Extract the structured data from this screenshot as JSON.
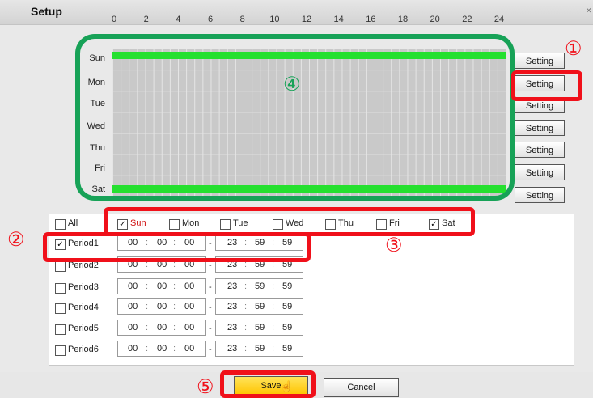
{
  "window": {
    "title": "Setup",
    "close_glyph": "×"
  },
  "hours": [
    "0",
    "2",
    "4",
    "6",
    "8",
    "10",
    "12",
    "14",
    "16",
    "18",
    "20",
    "22",
    "24"
  ],
  "days": [
    {
      "label": "Sun",
      "setting": "Setting",
      "full": true
    },
    {
      "label": "Mon",
      "setting": "Setting",
      "full": false
    },
    {
      "label": "Tue",
      "setting": "Setting",
      "full": false
    },
    {
      "label": "Wed",
      "setting": "Setting",
      "full": false
    },
    {
      "label": "Thu",
      "setting": "Setting",
      "full": false
    },
    {
      "label": "Fri",
      "setting": "Setting",
      "full": false
    },
    {
      "label": "Sat",
      "setting": "Setting",
      "full": true
    }
  ],
  "day_checks": {
    "all": {
      "label": "All",
      "checked": false
    },
    "items": [
      {
        "label": "Sun",
        "checked": true
      },
      {
        "label": "Mon",
        "checked": false
      },
      {
        "label": "Tue",
        "checked": false
      },
      {
        "label": "Wed",
        "checked": false
      },
      {
        "label": "Thu",
        "checked": false
      },
      {
        "label": "Fri",
        "checked": false
      },
      {
        "label": "Sat",
        "checked": true
      }
    ]
  },
  "periods": [
    {
      "label": "Period1",
      "checked": true,
      "start": [
        "00",
        "00",
        "00"
      ],
      "end": [
        "23",
        "59",
        "59"
      ]
    },
    {
      "label": "Period2",
      "checked": false,
      "start": [
        "00",
        "00",
        "00"
      ],
      "end": [
        "23",
        "59",
        "59"
      ]
    },
    {
      "label": "Period3",
      "checked": false,
      "start": [
        "00",
        "00",
        "00"
      ],
      "end": [
        "23",
        "59",
        "59"
      ]
    },
    {
      "label": "Period4",
      "checked": false,
      "start": [
        "00",
        "00",
        "00"
      ],
      "end": [
        "23",
        "59",
        "59"
      ]
    },
    {
      "label": "Period5",
      "checked": false,
      "start": [
        "00",
        "00",
        "00"
      ],
      "end": [
        "23",
        "59",
        "59"
      ]
    },
    {
      "label": "Period6",
      "checked": false,
      "start": [
        "00",
        "00",
        "00"
      ],
      "end": [
        "23",
        "59",
        "59"
      ]
    }
  ],
  "buttons": {
    "save": "Save",
    "cancel": "Cancel"
  },
  "annotations": [
    "①",
    "②",
    "③",
    "④",
    "⑤"
  ],
  "colors": {
    "accent_green": "#25e02f",
    "annotation_red": "#f0101a",
    "annotation_green": "#17a257",
    "save_yellow": "#ffd21a"
  }
}
